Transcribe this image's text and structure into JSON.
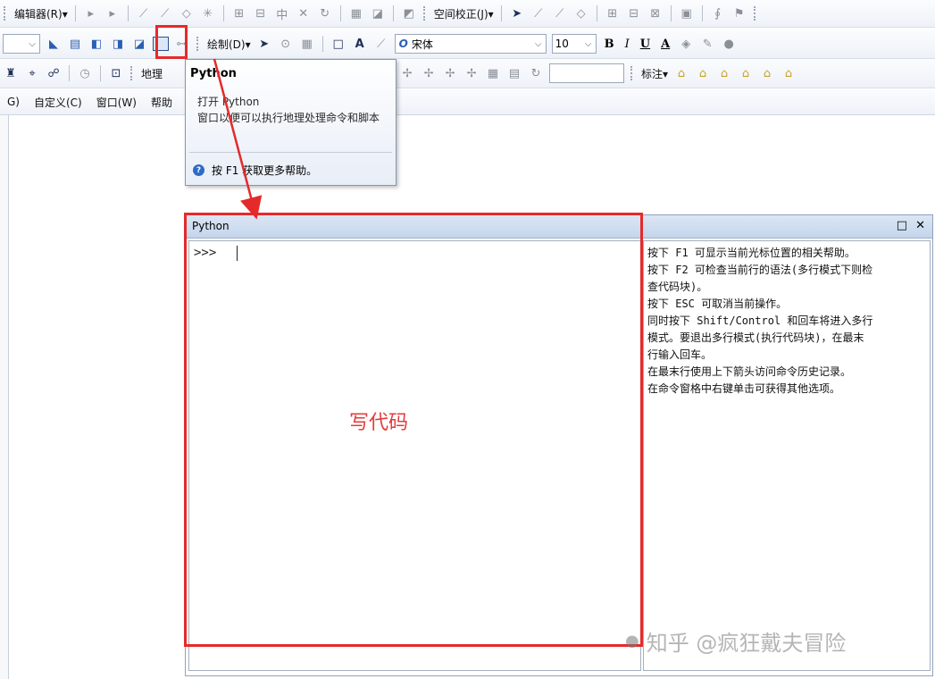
{
  "toolbar1": {
    "editor_menu": "编辑器(R)▾",
    "spatial_adjust_menu": "空间校正(J)▾"
  },
  "toolbar2": {
    "draw_menu": "绘制(D)▾",
    "font_name": "宋体",
    "font_size": "10",
    "bold": "B",
    "italic": "I",
    "underline": "U",
    "font_color_label": "A"
  },
  "toolbar3": {
    "geoprocessing_label": "地理",
    "annotation_label": "标注▾"
  },
  "menubar": {
    "items": [
      "G)",
      "自定义(C)",
      "窗口(W)",
      "帮助"
    ]
  },
  "tooltip": {
    "title": "Python",
    "body": "打开 Python\n窗口以便可以执行地理处理命令和脚本",
    "help": "按 F1 获取更多帮助。"
  },
  "python_window": {
    "title": "Python",
    "prompt": ">>>",
    "help_lines": [
      "按下 F1 可显示当前光标位置的相关帮助。",
      "按下 F2 可检查当前行的语法(多行模式下则检",
      "查代码块)。",
      "按下 ESC 可取消当前操作。",
      "同时按下 Shift/Control 和回车将进入多行",
      "模式。要退出多行模式(执行代码块)，在最末",
      "行输入回车。",
      "在最末行使用上下箭头访问命令历史记录。",
      "在命令窗格中右键单击可获得其他选项。"
    ]
  },
  "annotation": {
    "write_code": "写代码",
    "accent_color": "#e52a2a"
  },
  "watermark": {
    "text": "知乎 @疯狂戴夫冒险"
  }
}
